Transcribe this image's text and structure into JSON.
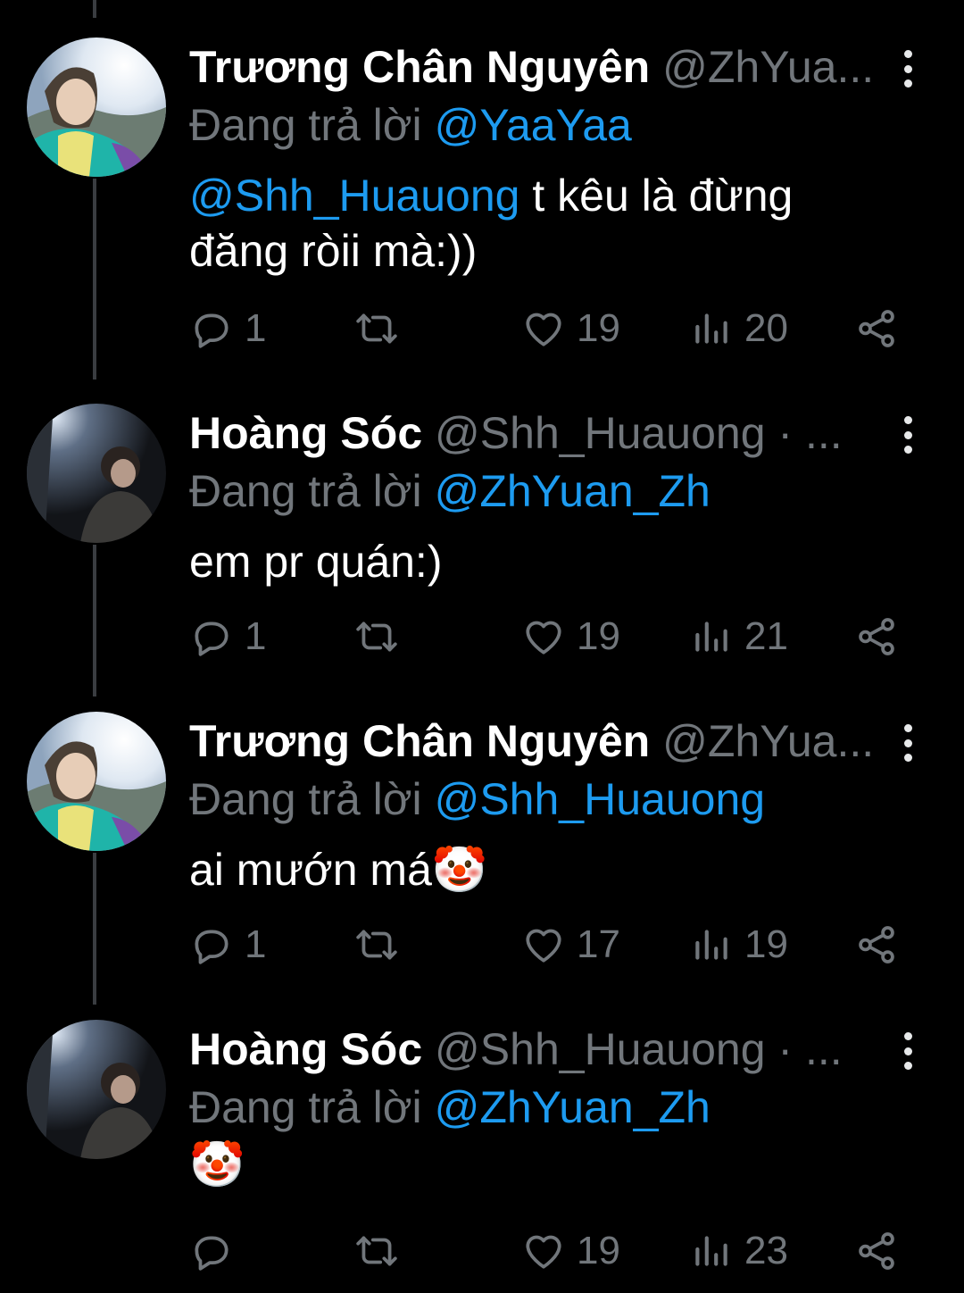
{
  "tweets": [
    {
      "display_name": "Trương Chân Nguyên",
      "handle": "@ZhYua...",
      "replying_prefix": "Đang trả lời",
      "replying_to": "@YaaYaa",
      "body_mention": "@Shh_Huauong",
      "body_text": " t kêu là đừng đăng ròii mà:))",
      "body_emoji": "",
      "replies": "1",
      "retweets": "",
      "likes": "19",
      "views": "20",
      "avatar": "avatar-boy-sunlight"
    },
    {
      "display_name": "Hoàng Sóc",
      "handle": "@Shh_Huauong · ...",
      "replying_prefix": "Đang trả lời",
      "replying_to": "@ZhYuan_Zh",
      "body_mention": "",
      "body_text": "em pr quán:)",
      "body_emoji": "",
      "replies": "1",
      "retweets": "",
      "likes": "19",
      "views": "21",
      "avatar": "avatar-boy-dark"
    },
    {
      "display_name": "Trương Chân Nguyên",
      "handle": "@ZhYua...",
      "replying_prefix": "Đang trả lời",
      "replying_to": "@Shh_Huauong",
      "body_mention": "",
      "body_text": "ai mướn má",
      "body_emoji": "🤡",
      "replies": "1",
      "retweets": "",
      "likes": "17",
      "views": "19",
      "avatar": "avatar-boy-sunlight"
    },
    {
      "display_name": "Hoàng Sóc",
      "handle": "@Shh_Huauong · ...",
      "replying_prefix": "Đang trả lời",
      "replying_to": "@ZhYuan_Zh",
      "body_mention": "",
      "body_text": "",
      "body_emoji": "🤡",
      "replies": "",
      "retweets": "",
      "likes": "19",
      "views": "23",
      "avatar": "avatar-boy-dark"
    }
  ],
  "colors": {
    "background": "#000000",
    "text": "#ffffff",
    "muted": "#71767b",
    "mention": "#1d9bf0",
    "thread_line": "#3a3d41"
  }
}
